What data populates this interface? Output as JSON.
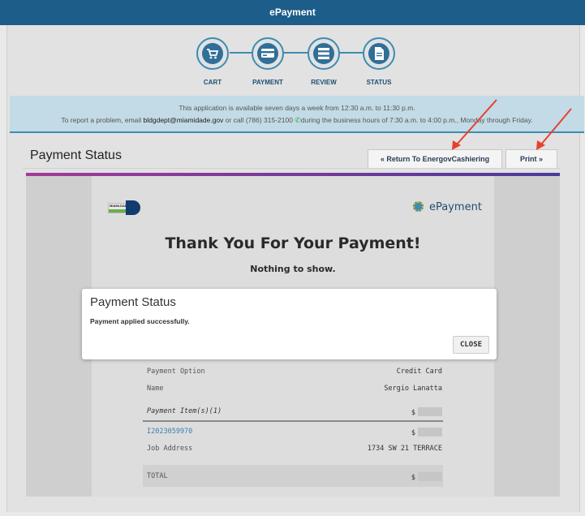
{
  "header": {
    "title": "ePayment"
  },
  "steps": [
    {
      "label": "CART",
      "icon": "cart-icon"
    },
    {
      "label": "PAYMENT",
      "icon": "credit-card-icon"
    },
    {
      "label": "REVIEW",
      "icon": "review-list-icon"
    },
    {
      "label": "STATUS",
      "icon": "document-icon"
    }
  ],
  "info": {
    "line1": "This application is available seven days a week from 12:30 a.m. to 11:30 p.m.",
    "line2_pre": "To report a problem, email ",
    "email": "bldgdept@miamidade.gov",
    "line2_mid": " or call (786) 315-2100 ",
    "line2_post": "during the business hours of 7:30 a.m. to 4:00 p.m., Monday through Friday."
  },
  "status_title": "Payment Status",
  "buttons": {
    "return": "« Return To EnergovCashiering",
    "print": "Print »"
  },
  "receipt": {
    "logo_text": "MIAMI-DADE COUNTY",
    "brand": "ePayment",
    "thanks": "Thank You For Your Payment!",
    "nothing": "Nothing to show.",
    "rows": {
      "payment_option": {
        "label": "Payment Option",
        "value": "Credit Card"
      },
      "name": {
        "label": "Name",
        "value": "Sergio Lanatta"
      },
      "items": {
        "label": "Payment Item(s)(1)",
        "value": "$"
      },
      "item_id": {
        "label": "I2023059970",
        "value": "$"
      },
      "job_address": {
        "label": "Job Address",
        "value": "1734 SW 21 TERRACE"
      },
      "total": {
        "label": "TOTAL",
        "value": "$"
      }
    }
  },
  "modal": {
    "title": "Payment Status",
    "message": "Payment applied successfully.",
    "close": "CLOSE"
  },
  "colors": {
    "brand": "#1d5d8a",
    "accent": "#3d8cb2",
    "annotation": "#e8402f"
  }
}
